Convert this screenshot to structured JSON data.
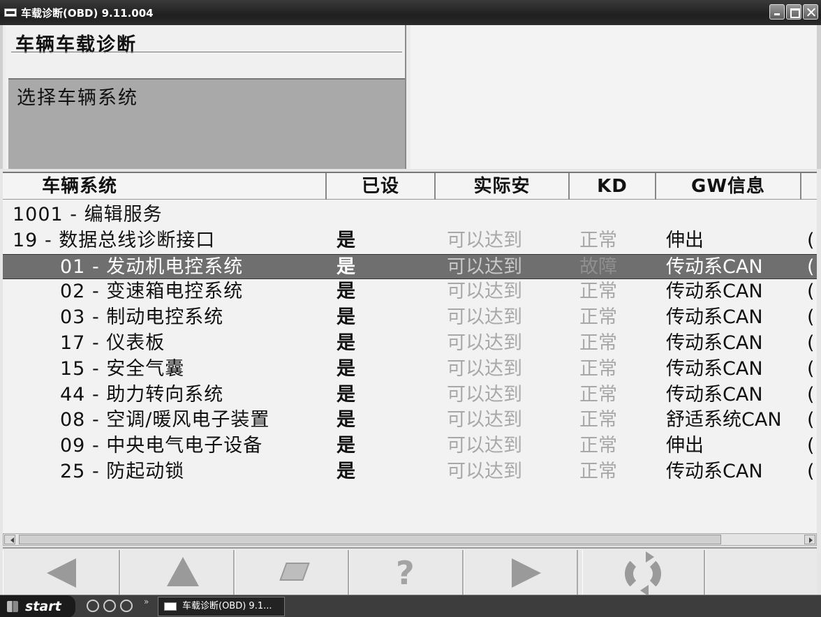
{
  "window": {
    "title": "车载诊断(OBD) 9.11.004"
  },
  "top": {
    "title": "车辆车载诊断",
    "subtitle": "选择车辆系统"
  },
  "table": {
    "headers": [
      "车辆系统",
      "已设",
      "实际安",
      "KD",
      "GW信息"
    ],
    "rows": [
      {
        "name": "1001 - 编辑服务",
        "set": "",
        "reach": "",
        "kd": "",
        "gw": "",
        "extra": ""
      },
      {
        "name": "19 - 数据总线诊断接口",
        "set": "是",
        "reach": "可以达到",
        "kd": "正常",
        "gw": "伸出",
        "extra": "("
      },
      {
        "name": "01 - 发动机电控系统",
        "set": "是",
        "reach": "可以达到",
        "kd": "故障",
        "gw": "传动系CAN",
        "extra": "("
      },
      {
        "name": "02 - 变速箱电控系统",
        "set": "是",
        "reach": "可以达到",
        "kd": "正常",
        "gw": "传动系CAN",
        "extra": "("
      },
      {
        "name": "03 - 制动电控系统",
        "set": "是",
        "reach": "可以达到",
        "kd": "正常",
        "gw": "传动系CAN",
        "extra": "("
      },
      {
        "name": "17 - 仪表板",
        "set": "是",
        "reach": "可以达到",
        "kd": "正常",
        "gw": "传动系CAN",
        "extra": "("
      },
      {
        "name": "15 - 安全气囊",
        "set": "是",
        "reach": "可以达到",
        "kd": "正常",
        "gw": "传动系CAN",
        "extra": "("
      },
      {
        "name": "44 - 助力转向系统",
        "set": "是",
        "reach": "可以达到",
        "kd": "正常",
        "gw": "传动系CAN",
        "extra": "("
      },
      {
        "name": "08 - 空调/暖风电子装置",
        "set": "是",
        "reach": "可以达到",
        "kd": "正常",
        "gw": "舒适系统CAN",
        "extra": "("
      },
      {
        "name": "09 - 中央电气电子设备",
        "set": "是",
        "reach": "可以达到",
        "kd": "正常",
        "gw": "伸出",
        "extra": "("
      },
      {
        "name": "25 - 防起动锁",
        "set": "是",
        "reach": "可以达到",
        "kd": "正常",
        "gw": "传动系CAN",
        "extra": "("
      }
    ]
  },
  "taskbar": {
    "start_label": "start",
    "task_label": "车载诊断(OBD) 9.1..."
  },
  "colors": {
    "selected_row": "#6f6f6f",
    "muted_text": "#a8a8a8",
    "panel_gray": "#a9a9a9"
  }
}
